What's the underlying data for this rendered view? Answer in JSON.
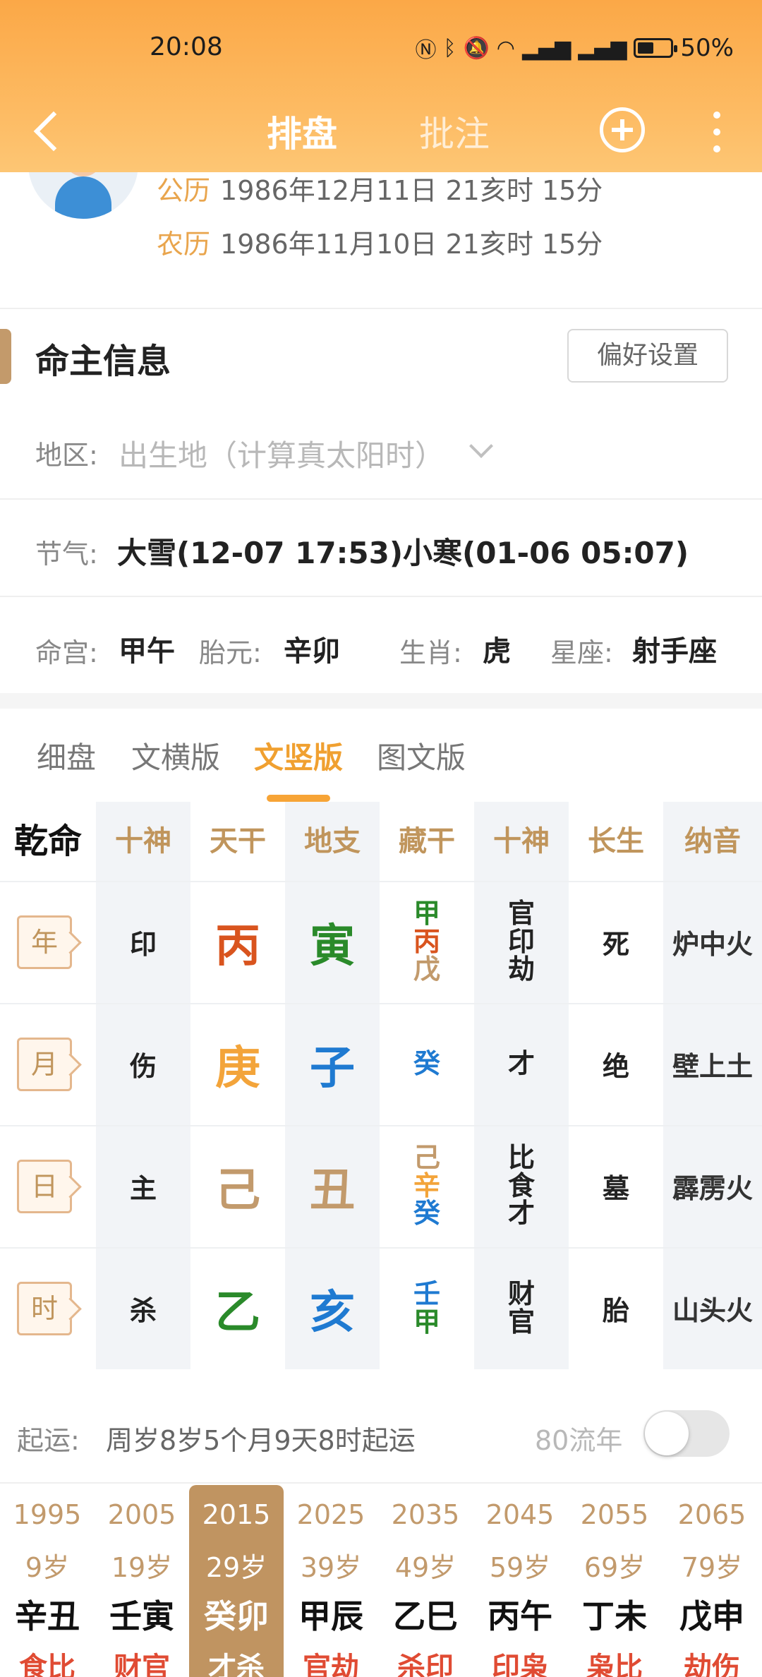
{
  "status_bar": {
    "time": "20:08",
    "battery_pct": "50%",
    "battery_level": 0.5
  },
  "nav": {
    "tab_active": "排盘",
    "tab_inactive": "批注"
  },
  "profile": {
    "solar_label": "公历",
    "solar_value": "1986年12月11日 21亥时 15分",
    "lunar_label": "农历",
    "lunar_value": "1986年11月10日 21亥时 15分"
  },
  "info": {
    "title": "命主信息",
    "pref_button": "偏好设置",
    "region_label": "地区:",
    "region_placeholder": "出生地（计算真太阳时）",
    "solar_term_label": "节气:",
    "solar_term_value": "大雪(12-07 17:53)小寒(01-06 05:07)",
    "minggong_label": "命宫:",
    "minggong_value": "甲午",
    "taiyuan_label": "胎元:",
    "taiyuan_value": "辛卯",
    "shengxiao_label": "生肖:",
    "shengxiao_value": "虎",
    "xingzuo_label": "星座:",
    "xingzuo_value": "射手座"
  },
  "layout_tabs": [
    "细盘",
    "文横版",
    "文竖版",
    "图文版"
  ],
  "layout_tab_active": 2,
  "table": {
    "corner": "乾命",
    "headers": [
      "十神",
      "天干",
      "地支",
      "藏干",
      "十神",
      "长生",
      "纳音"
    ],
    "rows": [
      {
        "pillar": "年",
        "shishen": "印",
        "gan": "丙",
        "gan_color": "#d9541e",
        "zhi": "寅",
        "zhi_color": "#2a8a2a",
        "canggan": [
          {
            "t": "甲",
            "c": "#2a8a2a"
          },
          {
            "t": "丙",
            "c": "#d9541e"
          },
          {
            "t": "戊",
            "c": "#c29a6c"
          }
        ],
        "cang_shishen": [
          "官",
          "印",
          "劫"
        ],
        "changsheng": "死",
        "nayin": "炉中火"
      },
      {
        "pillar": "月",
        "shishen": "伤",
        "gan": "庚",
        "gan_color": "#f3a43a",
        "zhi": "子",
        "zhi_color": "#1f7ad1",
        "canggan": [
          {
            "t": "癸",
            "c": "#1f7ad1"
          }
        ],
        "cang_shishen": [
          "才"
        ],
        "changsheng": "绝",
        "nayin": "壁上土"
      },
      {
        "pillar": "日",
        "shishen": "主",
        "gan": "己",
        "gan_color": "#c29a6c",
        "zhi": "丑",
        "zhi_color": "#c29a6c",
        "canggan": [
          {
            "t": "己",
            "c": "#c29a6c"
          },
          {
            "t": "辛",
            "c": "#f3a43a"
          },
          {
            "t": "癸",
            "c": "#1f7ad1"
          }
        ],
        "cang_shishen": [
          "比",
          "食",
          "才"
        ],
        "changsheng": "墓",
        "nayin": "霹雳火"
      },
      {
        "pillar": "时",
        "shishen": "杀",
        "gan": "乙",
        "gan_color": "#2a8a2a",
        "zhi": "亥",
        "zhi_color": "#1f7ad1",
        "canggan": [
          {
            "t": "壬",
            "c": "#1f7ad1"
          },
          {
            "t": "甲",
            "c": "#2a8a2a"
          }
        ],
        "cang_shishen": [
          "财",
          "官"
        ],
        "changsheng": "胎",
        "nayin": "山头火"
      }
    ]
  },
  "qiyun": {
    "label": "起运:",
    "value": "周岁8岁5个月9天8时起运",
    "liunian_label": "80流年",
    "liunian_on": false
  },
  "luck": [
    {
      "year": "1995",
      "age": "9岁",
      "ganzhi": "辛丑",
      "shishen": "食比"
    },
    {
      "year": "2005",
      "age": "19岁",
      "ganzhi": "壬寅",
      "shishen": "财官"
    },
    {
      "year": "2015",
      "age": "29岁",
      "ganzhi": "癸卯",
      "shishen": "才杀",
      "active": true
    },
    {
      "year": "2025",
      "age": "39岁",
      "ganzhi": "甲辰",
      "shishen": "官劫"
    },
    {
      "year": "2035",
      "age": "49岁",
      "ganzhi": "乙巳",
      "shishen": "杀印"
    },
    {
      "year": "2045",
      "age": "59岁",
      "ganzhi": "丙午",
      "shishen": "印枭"
    },
    {
      "year": "2055",
      "age": "69岁",
      "ganzhi": "丁未",
      "shishen": "枭比"
    },
    {
      "year": "2065",
      "age": "79岁",
      "ganzhi": "戊申",
      "shishen": "劫伤"
    }
  ]
}
